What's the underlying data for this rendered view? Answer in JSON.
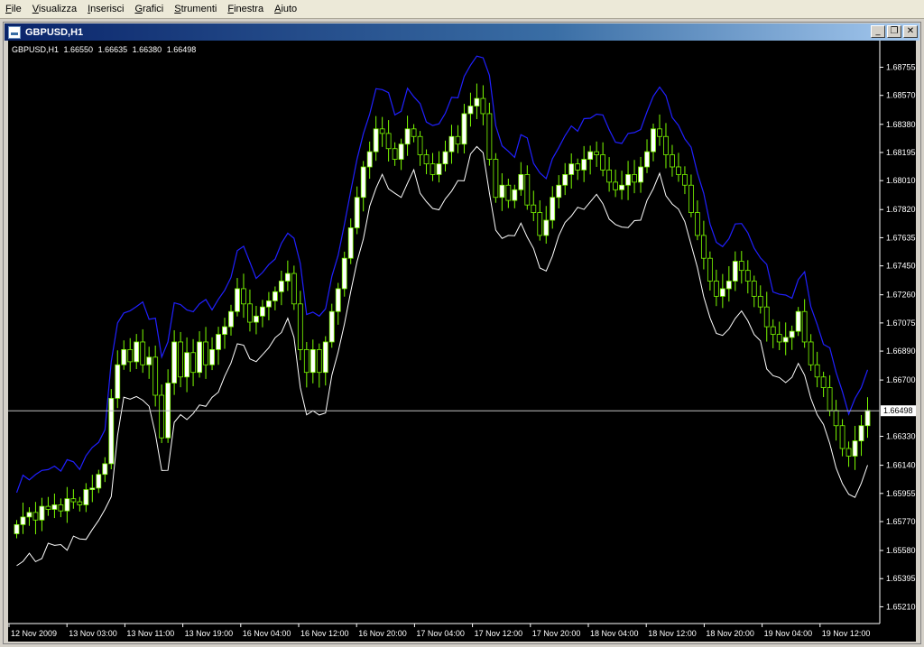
{
  "menu": [
    "File",
    "Visualizza",
    "Inserisci",
    "Grafici",
    "Strumenti",
    "Finestra",
    "Aiuto"
  ],
  "window": {
    "title": "GBPUSD,H1",
    "minimize": "_",
    "restore": "❐",
    "close": "✕"
  },
  "info": {
    "symbol": "GBPUSD,H1",
    "open": "1.66550",
    "high": "1.66635",
    "low": "1.66380",
    "close": "1.66498"
  },
  "colors": {
    "background": "#000000",
    "bull": "#ffffff",
    "bear": "#000000",
    "wick": "#7cfc00",
    "upper_band": "#2020ff",
    "lower_band": "#ffffff",
    "price_line": "#c0c0c0"
  },
  "chart_data": {
    "type": "candlestick",
    "ylim": [
      1.651,
      1.6893
    ],
    "y_ticks": [
      "1.68755",
      "1.68570",
      "1.68380",
      "1.68195",
      "1.68010",
      "1.67820",
      "1.67635",
      "1.67450",
      "1.67260",
      "1.67075",
      "1.66890",
      "1.66700",
      "1.66330",
      "1.66140",
      "1.65955",
      "1.65770",
      "1.65580",
      "1.65395",
      "1.65210"
    ],
    "x_ticks": [
      "12 Nov 2009",
      "13 Nov 03:00",
      "13 Nov 11:00",
      "13 Nov 19:00",
      "16 Nov 04:00",
      "16 Nov 12:00",
      "16 Nov 20:00",
      "17 Nov 04:00",
      "17 Nov 12:00",
      "17 Nov 20:00",
      "18 Nov 04:00",
      "18 Nov 12:00",
      "18 Nov 20:00",
      "19 Nov 04:00",
      "19 Nov 12:00"
    ],
    "current_price": "1.66498",
    "ohlc_close": [
      1.6575,
      1.658,
      1.6583,
      1.6578,
      1.6587,
      1.6585,
      1.6588,
      1.6584,
      1.6592,
      1.659,
      1.6588,
      1.6598,
      1.6599,
      1.6608,
      1.6615,
      1.6658,
      1.668,
      1.669,
      1.6682,
      1.6695,
      1.668,
      1.6685,
      1.666,
      1.6632,
      1.6668,
      1.6695,
      1.6672,
      1.6688,
      1.6675,
      1.6695,
      1.668,
      1.669,
      1.67,
      1.6705,
      1.6715,
      1.673,
      1.672,
      1.6708,
      1.6712,
      1.6718,
      1.6722,
      1.6728,
      1.6735,
      1.674,
      1.672,
      1.669,
      1.6675,
      1.669,
      1.6675,
      1.6695,
      1.6715,
      1.673,
      1.675,
      1.677,
      1.679,
      1.681,
      1.682,
      1.6835,
      1.6832,
      1.6822,
      1.6815,
      1.6825,
      1.6835,
      1.683,
      1.6818,
      1.6812,
      1.6805,
      1.6812,
      1.682,
      1.683,
      1.6825,
      1.6845,
      1.685,
      1.6855,
      1.6845,
      1.6815,
      1.679,
      1.6798,
      1.6788,
      1.6795,
      1.6805,
      1.6785,
      1.678,
      1.6765,
      1.6775,
      1.679,
      1.6798,
      1.6805,
      1.6812,
      1.6808,
      1.6815,
      1.682,
      1.6818,
      1.6808,
      1.68,
      1.6795,
      1.6798,
      1.6805,
      1.68,
      1.681,
      1.682,
      1.6835,
      1.683,
      1.6818,
      1.681,
      1.6805,
      1.6798,
      1.678,
      1.6765,
      1.675,
      1.6735,
      1.6725,
      1.673,
      1.6735,
      1.6748,
      1.6742,
      1.6735,
      1.6725,
      1.6718,
      1.6705,
      1.67,
      1.6695,
      1.6698,
      1.6702,
      1.6715,
      1.6695,
      1.668,
      1.6672,
      1.6665,
      1.665,
      1.664,
      1.6625,
      1.662,
      1.663,
      1.664,
      1.665
    ]
  }
}
